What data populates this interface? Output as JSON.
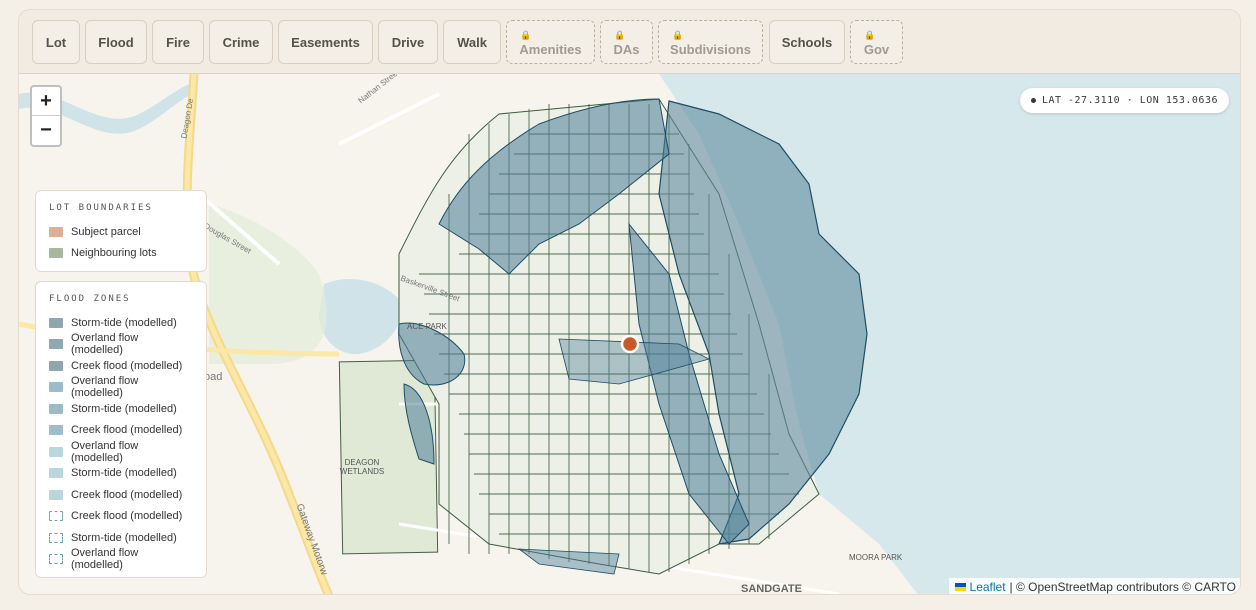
{
  "tabs": [
    {
      "label": "Lot",
      "state": "active"
    },
    {
      "label": "Flood",
      "state": "active"
    },
    {
      "label": "Fire",
      "state": "default"
    },
    {
      "label": "Crime",
      "state": "default"
    },
    {
      "label": "Easements",
      "state": "default"
    },
    {
      "label": "Drive",
      "state": "default"
    },
    {
      "label": "Walk",
      "state": "default"
    },
    {
      "label": "Amenities",
      "state": "locked"
    },
    {
      "label": "DAs",
      "state": "locked"
    },
    {
      "label": "Subdivisions",
      "state": "locked"
    },
    {
      "label": "Schools",
      "state": "default"
    },
    {
      "label": "Gov",
      "state": "locked"
    }
  ],
  "map": {
    "zoom_in": "+",
    "zoom_out": "−",
    "coords": "LAT -27.3110 · LON 153.0636",
    "labels": {
      "nathan": "Nathan Street",
      "douglas": "Douglas Street",
      "deagon_dev": "Deagon De",
      "deagon_wetlands": "DEAGON WETLANDS",
      "moora_park": "MOORA PARK",
      "sandgate": "SANDGATE",
      "gateway": "Gateway Motorw",
      "peace_park": "ACE PARK",
      "road": "oad",
      "baskerville": "Baskerville Street"
    }
  },
  "legend_lots": {
    "title": "LOT BOUNDARIES",
    "items": [
      {
        "label": "Subject parcel",
        "color": "#dcae93"
      },
      {
        "label": "Neighbouring lots",
        "color": "#a7b79c"
      }
    ]
  },
  "legend_flood": {
    "title": "FLOOD ZONES",
    "items": [
      {
        "label": "Storm-tide (modelled)",
        "color": "#8fa6ae",
        "style": "solid"
      },
      {
        "label": "Overland flow (modelled)",
        "color": "#90a8b1",
        "style": "solid"
      },
      {
        "label": "Creek flood (modelled)",
        "color": "#8ea6ae",
        "style": "solid"
      },
      {
        "label": "Overland flow (modelled)",
        "color": "#9cbcc8",
        "style": "solid"
      },
      {
        "label": "Storm-tide (modelled)",
        "color": "#9bbcc6",
        "style": "solid"
      },
      {
        "label": "Creek flood (modelled)",
        "color": "#9dbdc8",
        "style": "solid"
      },
      {
        "label": "Overland flow (modelled)",
        "color": "#b9d7df",
        "style": "solid"
      },
      {
        "label": "Storm-tide (modelled)",
        "color": "#b8d6de",
        "style": "solid"
      },
      {
        "label": "Creek flood (modelled)",
        "color": "#b9d6de",
        "style": "solid"
      },
      {
        "label": "Creek flood (modelled)",
        "color": "#6f9fb6",
        "style": "dashed"
      },
      {
        "label": "Storm-tide (modelled)",
        "color": "#6f9fb6",
        "style": "dashed"
      },
      {
        "label": "Overland flow (modelled)",
        "color": "#6f9fb6",
        "style": "dashed"
      }
    ]
  },
  "attribution": {
    "leaflet": "Leaflet",
    "text": "| © OpenStreetMap contributors © CARTO"
  }
}
